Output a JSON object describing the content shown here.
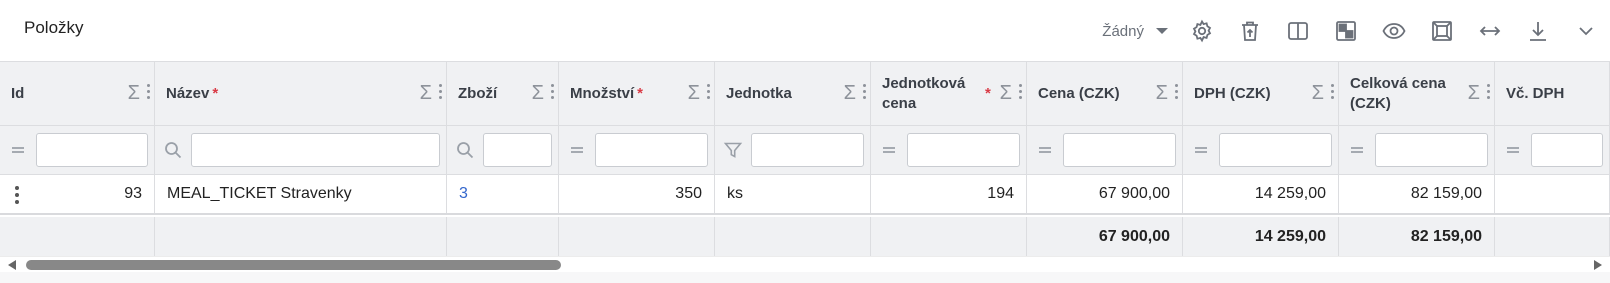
{
  "header": {
    "title": "Položky"
  },
  "toolbar": {
    "preset_value": "Žádný",
    "icons": [
      "settings-icon",
      "delete-icon",
      "columns-icon",
      "layout-icon",
      "eye-icon",
      "fit-icon",
      "width-icon",
      "download-icon",
      "collapse-icon"
    ]
  },
  "columns": [
    {
      "label": "Id",
      "required": false
    },
    {
      "label": "Název",
      "required": true
    },
    {
      "label": "Zboží",
      "required": false
    },
    {
      "label": "Množství",
      "required": true
    },
    {
      "label": "Jednotka",
      "required": false
    },
    {
      "label": "Jednotková cena",
      "required": true
    },
    {
      "label": "Cena (CZK)",
      "required": false
    },
    {
      "label": "DPH (CZK)",
      "required": false
    },
    {
      "label": "Celková cena (CZK)",
      "required": false
    },
    {
      "label": "Vč. DPH",
      "required": false
    }
  ],
  "filter_icons": [
    "equals-icon",
    "search-icon",
    "search-icon",
    "equals-icon",
    "filter-icon",
    "equals-icon",
    "equals-icon",
    "equals-icon",
    "equals-icon",
    "equals-icon"
  ],
  "rows": [
    {
      "id": "93",
      "nazev": "MEAL_TICKET Stravenky",
      "zbozi": "3",
      "mnozstvi": "350",
      "jednotka": "ks",
      "jednotkova_cena": "194",
      "cena": "67 900,00",
      "dph": "14 259,00",
      "celkova_cena": "82 159,00"
    }
  ],
  "totals": {
    "cena": "67 900,00",
    "dph": "14 259,00",
    "celkova_cena": "82 159,00"
  },
  "required_marker": "*",
  "sum_symbol": "Σ",
  "colors": {
    "required": "#d93a45",
    "link": "#3366cc",
    "header_bg": "#f0f1f3"
  }
}
